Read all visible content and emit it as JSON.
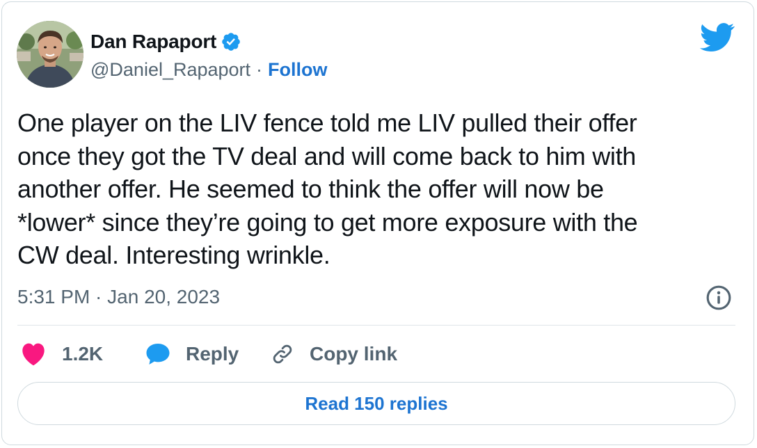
{
  "author": {
    "display_name": "Dan Rapaport",
    "handle": "@Daniel_Rapaport",
    "separator": "·",
    "follow_label": "Follow",
    "verified": true
  },
  "tweet": {
    "text": "One player on the LIV fence told me LIV pulled their offer\nonce they got the TV deal and will come back to him with\nanother offer. He seemed to think the offer will now be\n*lower* since they’re going to get more exposure with the\nCW deal. Interesting wrinkle.",
    "timestamp": "5:31 PM · Jan 20, 2023"
  },
  "actions": {
    "likes_count": "1.2K",
    "reply_label": "Reply",
    "copy_link_label": "Copy link",
    "read_replies_label": "Read 150 replies"
  },
  "icons": {
    "brand": "twitter-bird-icon",
    "verified": "verified-badge-icon",
    "info": "info-icon",
    "like": "heart-icon",
    "reply": "speech-bubble-icon",
    "copy": "link-icon"
  },
  "colors": {
    "text": "#0f1419",
    "secondary": "#536471",
    "link": "#1d74d1",
    "twitter_blue": "#1d9bf0",
    "like": "#f91880",
    "border": "#cfd9de"
  }
}
